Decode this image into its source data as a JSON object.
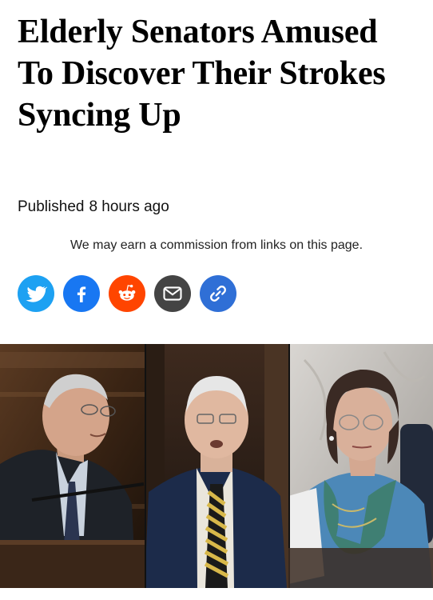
{
  "article": {
    "headline": "Elderly Senators Amused To Discover Their Strokes Syncing Up",
    "published_label": "Published",
    "published_time": "8 hours ago",
    "disclaimer": "We may earn a commission from links on this page."
  },
  "share": [
    {
      "icon": "twitter-icon",
      "color": "#1da1f2"
    },
    {
      "icon": "facebook-icon",
      "color": "#1877f2"
    },
    {
      "icon": "reddit-icon",
      "color": "#ff4500"
    },
    {
      "icon": "email-icon",
      "color": "#444444"
    },
    {
      "icon": "link-icon",
      "color": "#2f6fd6"
    }
  ]
}
